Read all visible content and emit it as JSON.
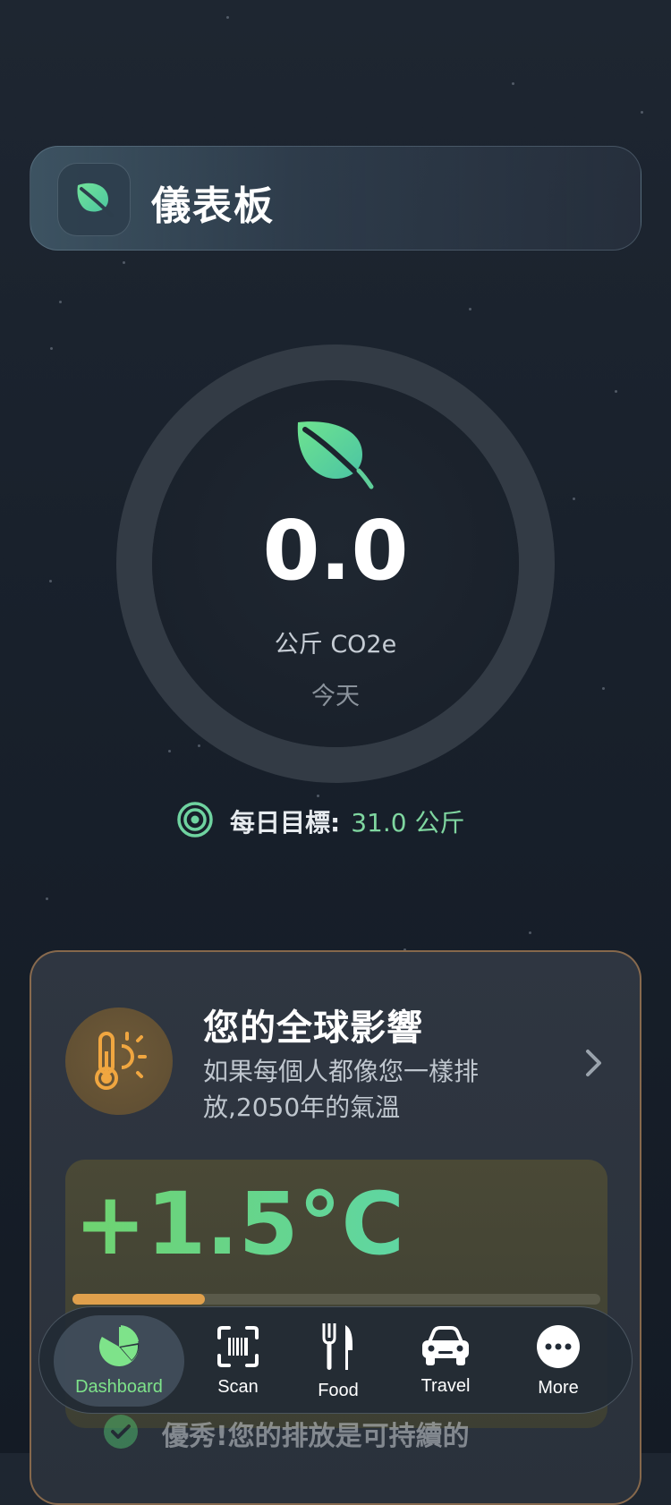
{
  "header": {
    "title": "儀表板",
    "icon": "leaf-icon"
  },
  "today": {
    "value": "0.0",
    "unit": "公斤 CO2e",
    "period": "今天"
  },
  "goal": {
    "label": "每日目標:",
    "value": "31.0 公斤"
  },
  "impact": {
    "title": "您的全球影響",
    "description": "如果每個人都像您一樣排放,2050年的氣溫",
    "temperature": "+1.5°C",
    "progress_fraction": 0.25,
    "status_text": "優秀!您的排放是可持續的"
  },
  "tabs": [
    {
      "label": "Dashboard",
      "icon": "pie-chart-icon",
      "active": true
    },
    {
      "label": "Scan",
      "icon": "barcode-scan-icon",
      "active": false
    },
    {
      "label": "Food",
      "icon": "fork-knife-icon",
      "active": false
    },
    {
      "label": "Travel",
      "icon": "car-icon",
      "active": false
    },
    {
      "label": "More",
      "icon": "more-icon",
      "active": false
    }
  ],
  "colors": {
    "accent_green": "#7fd6a0",
    "warm_orange": "#e0a04c",
    "background": "#18202b"
  }
}
